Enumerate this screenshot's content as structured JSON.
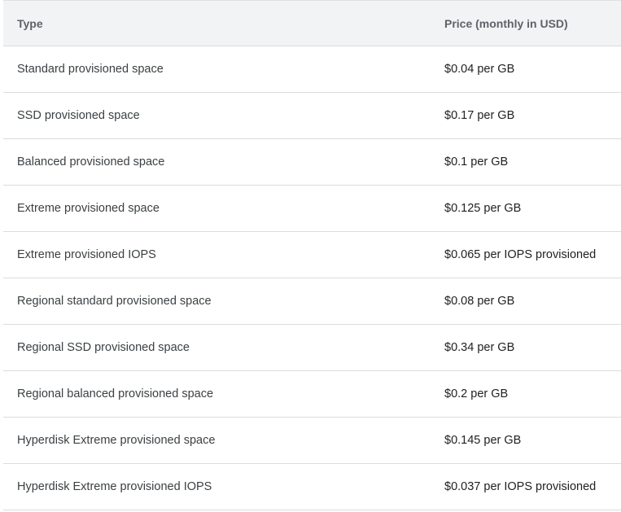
{
  "table": {
    "headers": {
      "type": "Type",
      "price": "Price (monthly in USD)"
    },
    "rows": [
      {
        "type": "Standard provisioned space",
        "price": "$0.04 per GB"
      },
      {
        "type": "SSD provisioned space",
        "price": "$0.17 per GB"
      },
      {
        "type": "Balanced provisioned space",
        "price": "$0.1 per GB"
      },
      {
        "type": "Extreme provisioned space",
        "price": "$0.125 per GB"
      },
      {
        "type": "Extreme provisioned IOPS",
        "price": "$0.065 per IOPS provisioned"
      },
      {
        "type": "Regional standard provisioned space",
        "price": "$0.08 per GB"
      },
      {
        "type": "Regional SSD provisioned space",
        "price": "$0.34 per GB"
      },
      {
        "type": "Regional balanced provisioned space",
        "price": "$0.2 per GB"
      },
      {
        "type": "Hyperdisk Extreme provisioned space",
        "price": "$0.145 per GB"
      },
      {
        "type": "Hyperdisk Extreme provisioned IOPS",
        "price": "$0.037 per IOPS provisioned"
      }
    ]
  },
  "colors": {
    "header_bg": "#f1f3f4",
    "border": "#dadce0",
    "text": "#3c4043"
  }
}
